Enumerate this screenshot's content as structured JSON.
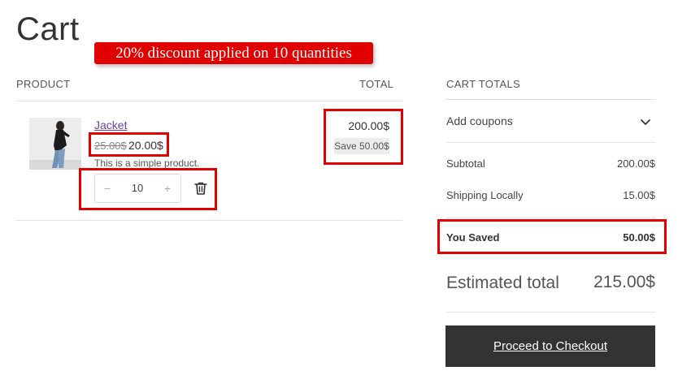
{
  "page": {
    "title": "Cart"
  },
  "promo": {
    "text": "20% discount applied on 10 quantities"
  },
  "table": {
    "col_product": "PRODUCT",
    "col_total": "TOTAL"
  },
  "item": {
    "name": "Jacket",
    "old_price": "25.00$",
    "new_price": "20.00$",
    "description": "This is a simple product.",
    "quantity": "10",
    "qty_minus": "−",
    "qty_plus": "+",
    "line_total": "200.00$",
    "save_badge": "Save 50.00$"
  },
  "totals": {
    "heading": "CART TOTALS",
    "coupons_label": "Add coupons",
    "subtotal_label": "Subtotal",
    "subtotal_value": "200.00$",
    "shipping_label": "Shipping Locally",
    "shipping_value": "15.00$",
    "saved_label": "You Saved",
    "saved_value": "50.00$",
    "estimated_label": "Estimated total",
    "estimated_value": "215.00$",
    "checkout_label": "Proceed to Checkout"
  },
  "icons": {
    "trash": "trash-icon",
    "coupon_toggle": "chevron-down-icon"
  },
  "colors": {
    "highlight": "#e00000",
    "link": "#6b3fa0",
    "button_bg": "#333333"
  }
}
